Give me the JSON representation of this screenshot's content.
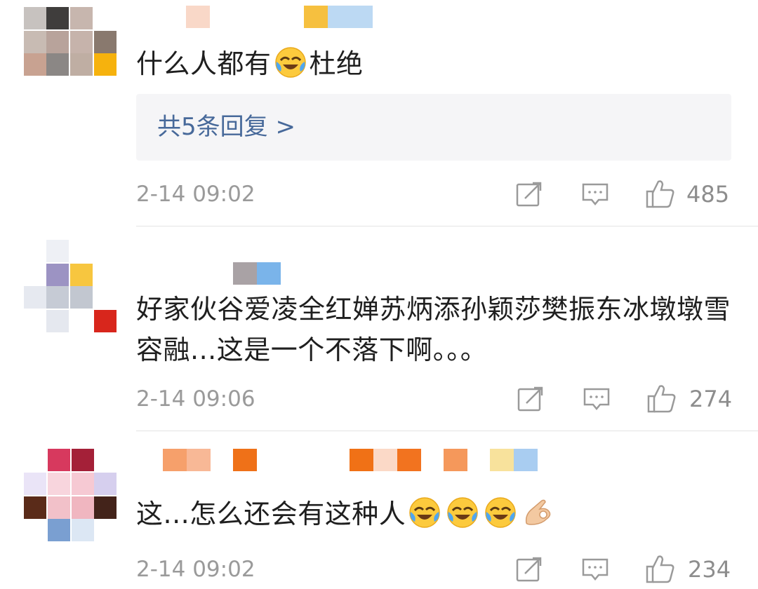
{
  "comments": [
    {
      "text": "什么人都有",
      "text_after_emoji": "杜绝",
      "emojis": [
        "laugh-cry-emoji"
      ],
      "replies_label": "共5条回复 >",
      "time": "2-14 09:02",
      "likes": "485",
      "avatar_colors": [
        "#c7c2bf",
        "#3f3d3c",
        "#c7b6ae",
        "#c8bbb3",
        "#b8a39b",
        "#c6b3ab",
        "#89796e",
        "#c8a291",
        "#8b8785",
        "#bfaea3",
        "#f6b20d"
      ],
      "name_colors": [
        "#f9d8c8",
        "#f6c03f",
        "#bcd9f3"
      ]
    },
    {
      "text": "好家伙谷爱凌全红婵苏炳添孙颖莎樊振东冰墩墩雪容融...这是一个不落下啊。。。",
      "time": "2-14 09:06",
      "likes": "274",
      "avatar_colors": [
        "#eef0f5",
        "#9c93c3",
        "#f7c63f",
        "#c6cbd5",
        "#c2c7d0",
        "#e6e9f0",
        "#e5e8ef",
        "#d8261c"
      ],
      "name_colors": [
        "#a9a2a5",
        "#7ab4ea"
      ]
    },
    {
      "text": "这...怎么还会有这种人",
      "emojis": [
        "laugh-cry-emoji",
        "laugh-cry-emoji",
        "laugh-cry-emoji",
        "ok-hand-emoji"
      ],
      "time": "2-14 09:02",
      "likes": "234",
      "avatar_colors": [
        "#d7395e",
        "#a42038",
        "#eae4f7",
        "#f8d5dd",
        "#f6c9d3",
        "#d6cfee",
        "#5a2b19",
        "#f2c1c9",
        "#f0b6c0",
        "#43231a",
        "#7a9fd1",
        "#dce7f4"
      ],
      "name_colors": [
        "#f6a06b",
        "#f8b896",
        "#ef7118",
        "#f07116",
        "#fbd9c7",
        "#f2731f",
        "#f5985b",
        "#f8e29c",
        "#a9cdf1"
      ]
    }
  ],
  "icons": [
    "share-icon",
    "comment-icon",
    "like-icon"
  ],
  "colors": {
    "reply_link": "#47699a",
    "meta_gray": "#9a9a9a",
    "reply_bg": "#f5f5f7"
  }
}
